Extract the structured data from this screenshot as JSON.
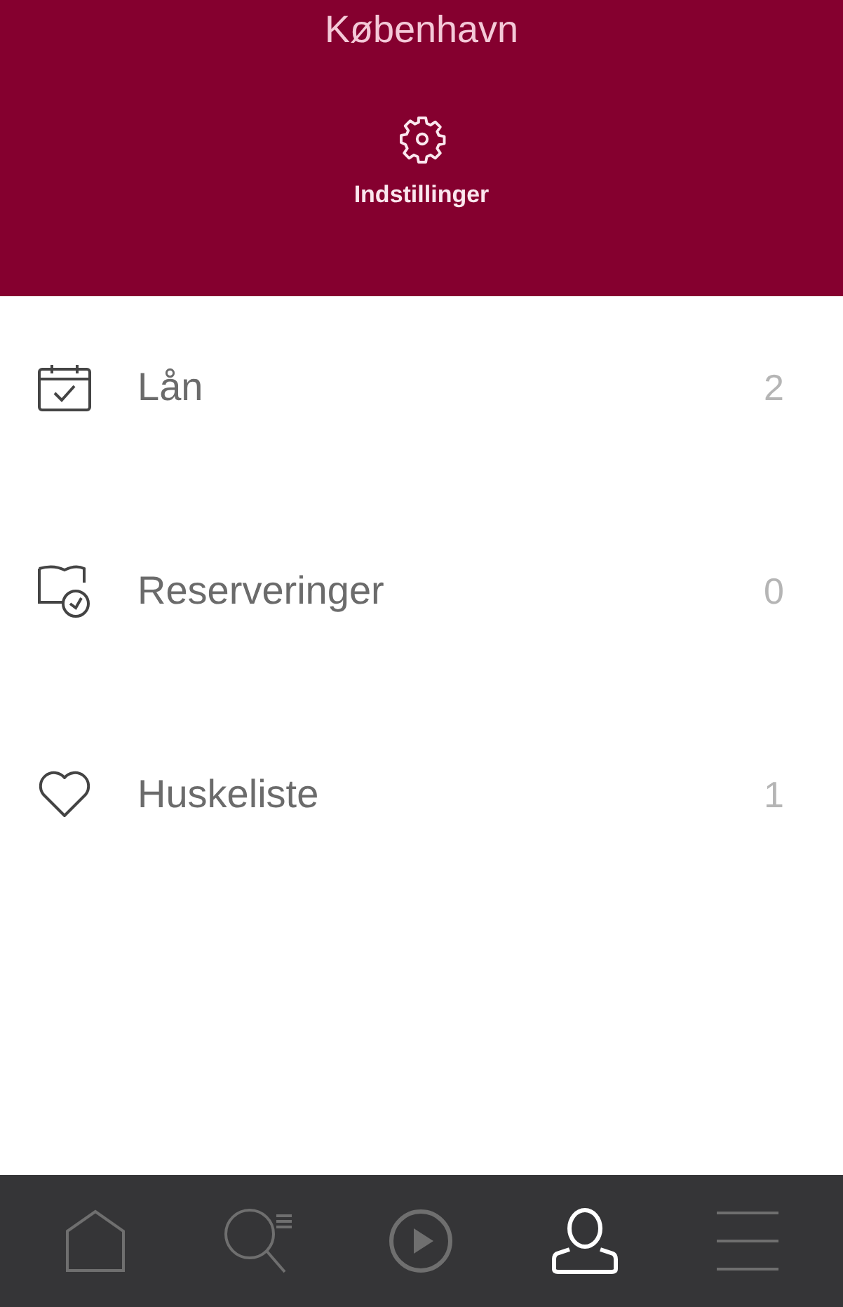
{
  "header": {
    "title": "København",
    "settings_label": "Indstillinger"
  },
  "menu_items": [
    {
      "kind": "loans",
      "label": "Lån",
      "count": "2"
    },
    {
      "kind": "reservations",
      "label": "Reserveringer",
      "count": "0"
    },
    {
      "kind": "wishlist",
      "label": "Huskeliste",
      "count": "1"
    }
  ],
  "tab_bar": [
    {
      "kind": "home",
      "selected": false
    },
    {
      "kind": "search",
      "selected": false
    },
    {
      "kind": "play",
      "selected": false
    },
    {
      "kind": "profile",
      "selected": true
    },
    {
      "kind": "menu",
      "selected": false
    }
  ]
}
